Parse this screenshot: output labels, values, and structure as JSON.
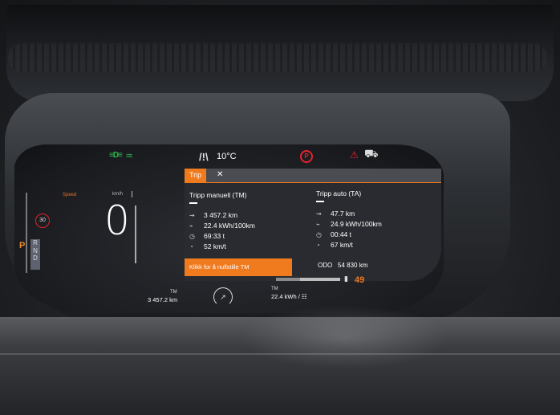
{
  "status": {
    "temperature": "10°C",
    "icons": [
      "eco-icon",
      "wiper-icon",
      "road-icon",
      "parking-brake-icon",
      "seatbelt-icon",
      "car-door-icon"
    ],
    "parking_brake_glyph": "P"
  },
  "speed_cluster": {
    "speed_label": "Speed",
    "unit_label": "km/h",
    "speed_limit": "30",
    "speed_value": "0",
    "gear_selected": "P",
    "gears": [
      "R",
      "N",
      "D"
    ]
  },
  "trip_panel": {
    "tab_label": "Trip",
    "close_glyph": "✕",
    "manual": {
      "title": "Tripp manuell (TM)",
      "distance": "3 457.2 km",
      "consumption": "22.4 kWh/100km",
      "time": "69:33 t",
      "avg_speed": "52 km/t"
    },
    "auto": {
      "title": "Tripp auto (TA)",
      "distance": "47.7 km",
      "consumption": "24.9 kWh/100km",
      "time": "00:44 t",
      "avg_speed": "67 km/t"
    },
    "reset_button": "Klikk for å nullstille TM",
    "odo_label": "ODO",
    "odo_value": "54 830 km"
  },
  "bottom": {
    "range_value": "49",
    "range_fraction": 0.37,
    "tm_left_label": "TM",
    "tm_left_value": "3 457.2 km",
    "tm_right_label": "TM",
    "tm_right_value": "22.4 kWh / ☷"
  },
  "colors": {
    "accent": "#f07a1e",
    "warning": "#e5232d",
    "eco": "#2fb84a"
  }
}
